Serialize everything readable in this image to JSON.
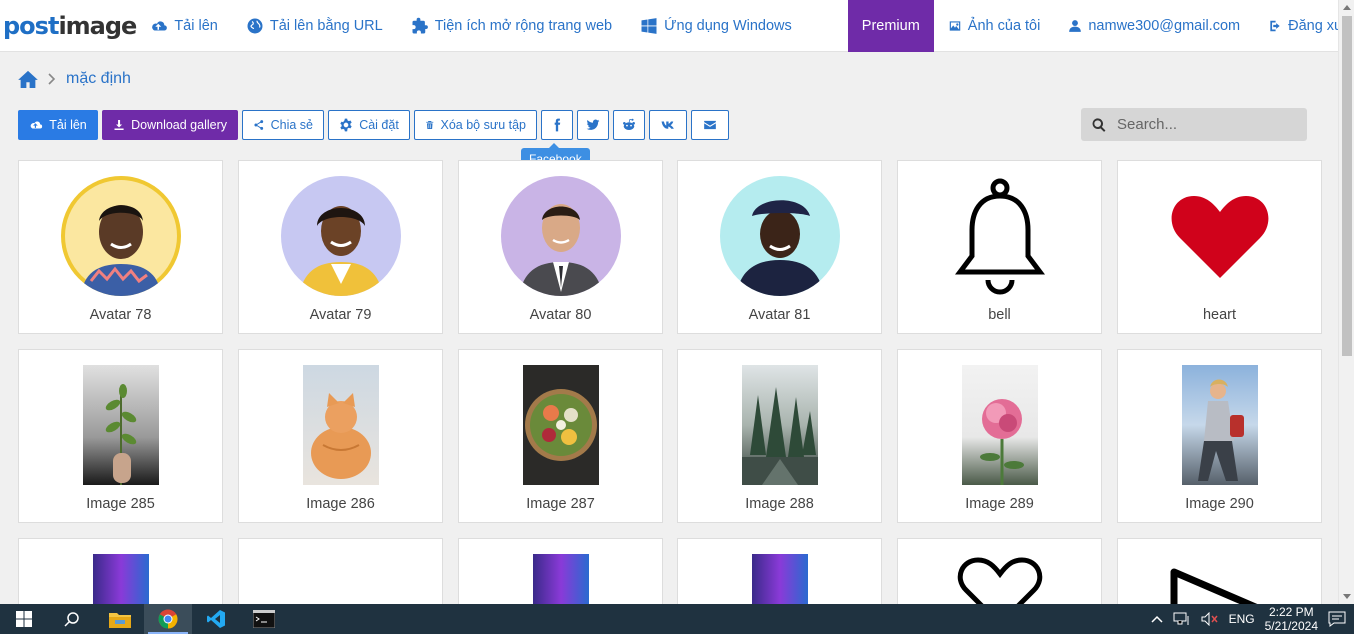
{
  "brand": {
    "logo_part1": "post",
    "logo_part2": "image"
  },
  "nav": {
    "upload": "Tải lên",
    "upload_url": "Tải lên bằng URL",
    "extensions": "Tiện ích mở rộng trang web",
    "windows_app": "Ứng dụng Windows",
    "premium": "Premium",
    "my_images": "Ảnh của tôi",
    "account": "namwe300@gmail.com",
    "logout": "Đăng xuất"
  },
  "breadcrumb": {
    "current": "mặc định"
  },
  "toolbar": {
    "upload": "Tải lên",
    "download_gallery": "Download gallery",
    "share": "Chia sẻ",
    "settings": "Cài đặt",
    "delete_collection": "Xóa bộ sưu tập"
  },
  "tooltip": {
    "text": "Facebook"
  },
  "search": {
    "placeholder": "Search..."
  },
  "gallery": {
    "row1": [
      "Avatar 78",
      "Avatar 79",
      "Avatar 80",
      "Avatar 81",
      "bell",
      "heart"
    ],
    "row2": [
      "Image 285",
      "Image 286",
      "Image 287",
      "Image 288",
      "Image 289",
      "Image 290"
    ]
  },
  "taskbar": {
    "lang": "ENG",
    "time": "2:22 PM",
    "date": "5/21/2024"
  },
  "colors": {
    "accent": "#2a73c8",
    "premium": "#6f2ba8",
    "heart": "#d0021b"
  }
}
